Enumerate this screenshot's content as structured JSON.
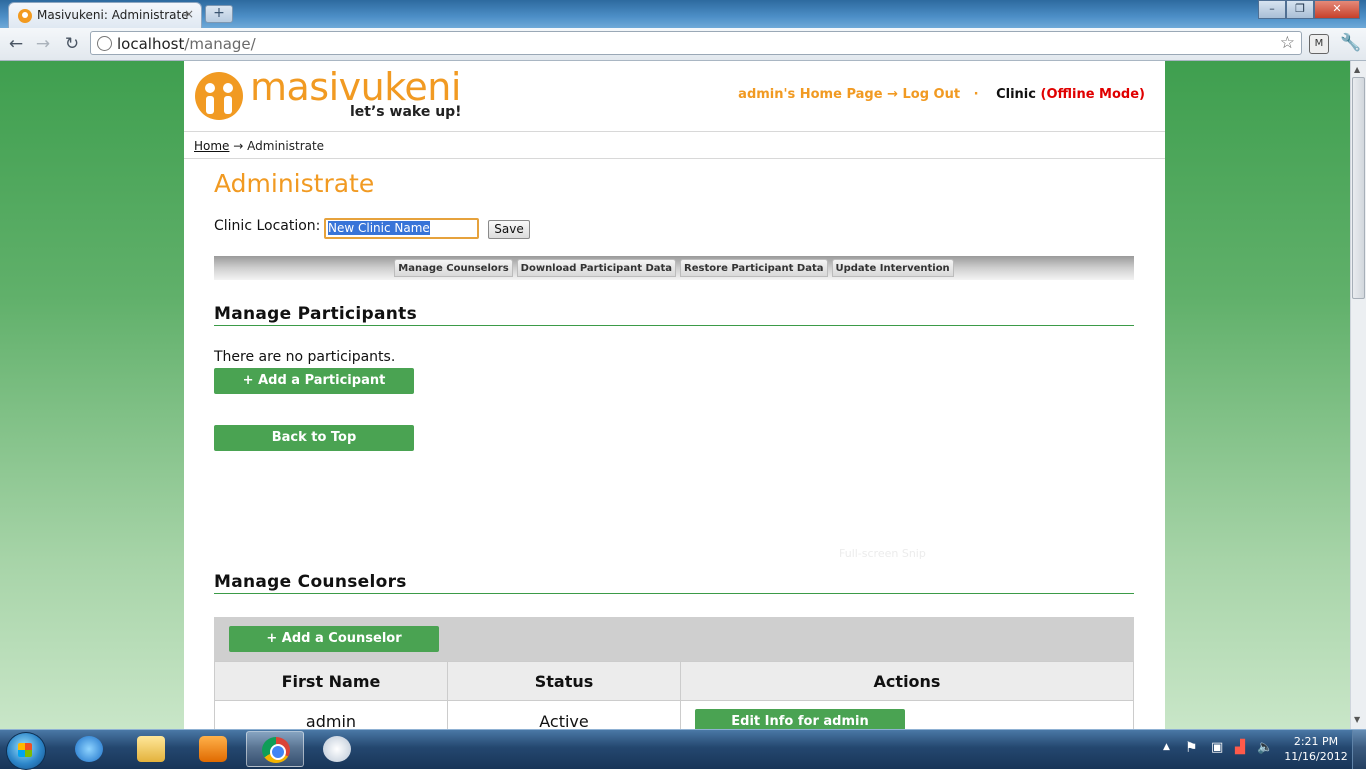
{
  "browser": {
    "tab_title": "Masivukeni: Administrate",
    "tab_close": "×",
    "new_tab": "+",
    "url_host": "localhost",
    "url_path": "/manage/",
    "window_controls": [
      "–",
      "❐",
      "✕"
    ]
  },
  "header": {
    "logo_text": "masivukeni",
    "tagline": "let’s wake up!",
    "home_link": "admin's Home Page",
    "arrow": "→",
    "logout": "Log Out",
    "separator": "·",
    "clinic_label": "Clinic",
    "mode": "(Offline Mode)"
  },
  "breadcrumb": {
    "home": "Home",
    "arrow": "→",
    "current": "Administrate"
  },
  "main": {
    "title": "Administrate",
    "clinic_location_label": "Clinic Location:",
    "clinic_input_value": "New Clinic Name",
    "save_label": "Save",
    "subnav": [
      "Manage Counselors",
      "Download Participant Data",
      "Restore Participant Data",
      "Update Intervention"
    ]
  },
  "participants": {
    "heading": "Manage Participants",
    "empty_text": "There are no participants.",
    "add_button": "+ Add a Participant",
    "back_to_top": "Back to Top"
  },
  "ghost_text": "Full-screen Snip",
  "counselors": {
    "heading": "Manage Counselors",
    "add_button": "+ Add a Counselor",
    "columns": [
      "First Name",
      "Status",
      "Actions"
    ],
    "rows": [
      {
        "first_name": "admin",
        "status": "Active",
        "action": "Edit Info for admin"
      }
    ]
  },
  "taskbar": {
    "time": "2:21 PM",
    "date": "11/16/2012",
    "tray_expand": "▲"
  },
  "colors": {
    "brand_orange": "#f19a22",
    "button_green": "#4aa352",
    "offline_red": "#e00000"
  }
}
